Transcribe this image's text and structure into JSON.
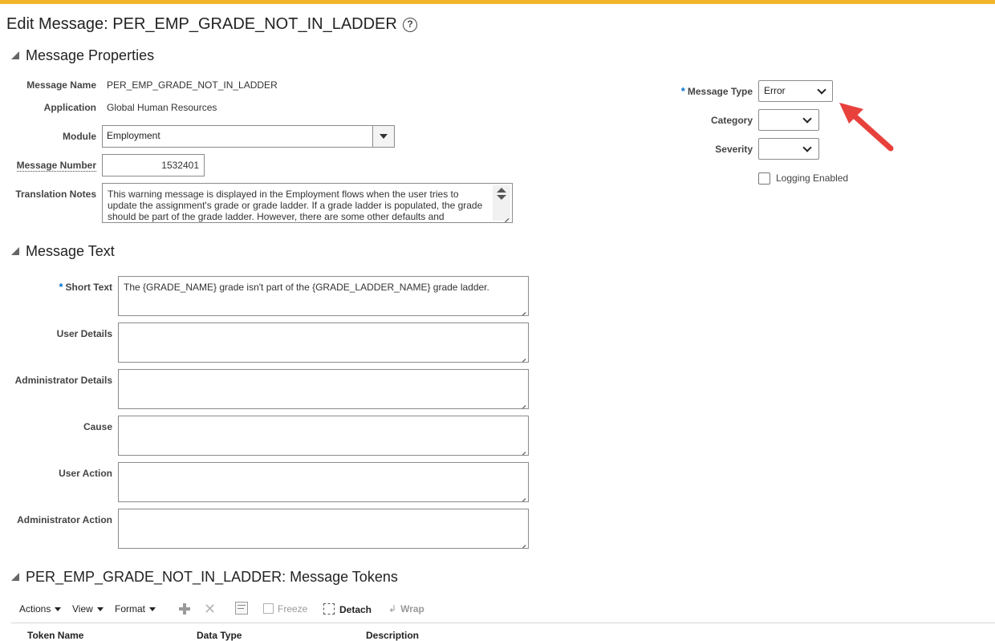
{
  "page": {
    "title": "Edit Message: PER_EMP_GRADE_NOT_IN_LADDER",
    "help_icon": "?"
  },
  "sections": {
    "properties_title": "Message Properties",
    "text_title": "Message Text",
    "tokens_title": "PER_EMP_GRADE_NOT_IN_LADDER: Message Tokens"
  },
  "properties": {
    "message_name_label": "Message Name",
    "message_name_value": "PER_EMP_GRADE_NOT_IN_LADDER",
    "application_label": "Application",
    "application_value": "Global Human Resources",
    "module_label": "Module",
    "module_value": "Employment",
    "message_number_label": "Message Number",
    "message_number_value": "1532401",
    "translation_notes_label": "Translation Notes",
    "translation_notes_value": "This warning message is displayed in the Employment flows when the user tries to update the assignment's grade or grade ladder. If a grade ladder is populated, the grade should be part of the grade ladder. However, there are some other defaults and validations in the",
    "message_type_label": "Message Type",
    "message_type_value": "Error",
    "category_label": "Category",
    "category_value": "",
    "severity_label": "Severity",
    "severity_value": "",
    "logging_enabled_label": "Logging Enabled",
    "logging_enabled": false
  },
  "message_text": {
    "short_text_label": "Short Text",
    "short_text_value": "The {GRADE_NAME} grade isn't part of the {GRADE_LADDER_NAME} grade ladder.",
    "user_details_label": "User Details",
    "user_details_value": "",
    "admin_details_label": "Administrator Details",
    "admin_details_value": "",
    "cause_label": "Cause",
    "cause_value": "",
    "user_action_label": "User Action",
    "user_action_value": "",
    "admin_action_label": "Administrator Action",
    "admin_action_value": ""
  },
  "toolbar": {
    "actions": "Actions",
    "view": "View",
    "format": "Format",
    "freeze": "Freeze",
    "detach": "Detach",
    "wrap": "Wrap"
  },
  "table": {
    "columns": [
      "Token Name",
      "Data Type",
      "Description"
    ]
  },
  "colors": {
    "accent_bar": "#f3b62a",
    "required_marker": "#0572ce",
    "arrow": "#e8413c"
  }
}
